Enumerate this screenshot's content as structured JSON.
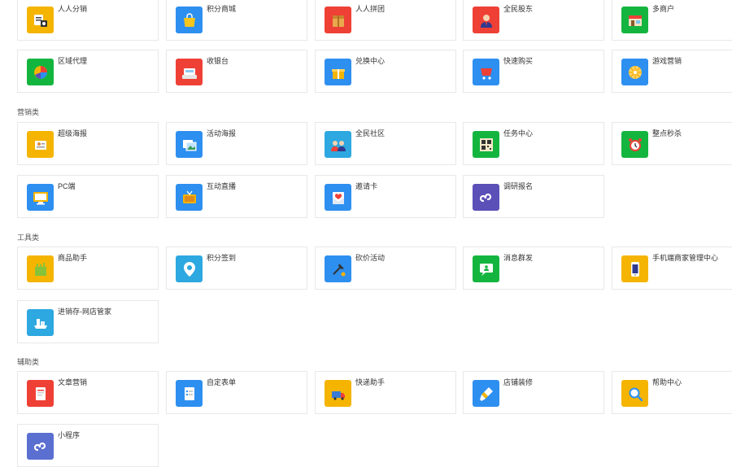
{
  "sections": [
    {
      "title": ""
    },
    {
      "title": "营销类"
    },
    {
      "title": "工具类"
    },
    {
      "title": "辅助类"
    }
  ],
  "apps": [
    {
      "label": "人人分销",
      "icon": "distribution-icon",
      "color": "#f5b400"
    },
    {
      "label": "积分商城",
      "icon": "shopping-bag-icon",
      "color": "#2d8ff0"
    },
    {
      "label": "人人拼团",
      "icon": "group-buy-box-icon",
      "color": "#ef4036"
    },
    {
      "label": "全民股东",
      "icon": "shareholder-person-icon",
      "color": "#ef4036"
    },
    {
      "label": "多商户",
      "icon": "multi-store-icon",
      "color": "#14b53f"
    },
    {
      "label": "区域代理",
      "icon": "region-agent-pie-icon",
      "color": "#14b53f"
    },
    {
      "label": "收银台",
      "icon": "cashier-icon",
      "color": "#ef4036"
    },
    {
      "label": "兑换中心",
      "icon": "gift-icon",
      "color": "#2d8ff0"
    },
    {
      "label": "快速购买",
      "icon": "quick-buy-cart-icon",
      "color": "#2d8ff0"
    },
    {
      "label": "游戏营销",
      "icon": "game-wheel-icon",
      "color": "#2d8ff0"
    },
    {
      "label": "超级海报",
      "icon": "super-poster-icon",
      "color": "#f5b400"
    },
    {
      "label": "活动海报",
      "icon": "activity-poster-icon",
      "color": "#2d8ff0"
    },
    {
      "label": "全民社区",
      "icon": "community-icon",
      "color": "#2da8e0"
    },
    {
      "label": "任务中心",
      "icon": "task-qrcode-icon",
      "color": "#14b53f"
    },
    {
      "label": "整点秒杀",
      "icon": "alarm-clock-icon",
      "color": "#14b53f"
    },
    {
      "label": "PC端",
      "icon": "desktop-monitor-icon",
      "color": "#2d8ff0"
    },
    {
      "label": "互动直播",
      "icon": "live-tv-icon",
      "color": "#2d8ff0"
    },
    {
      "label": "邀请卡",
      "icon": "invite-card-icon",
      "color": "#2d8ff0"
    },
    {
      "label": "调研报名",
      "icon": "mini-program-icon",
      "color": "#5b4fb8"
    },
    {
      "label": "商品助手",
      "icon": "goods-assistant-icon",
      "color": "#f5b400"
    },
    {
      "label": "积分签到",
      "icon": "points-signin-pin-icon",
      "color": "#2da8e0"
    },
    {
      "label": "砍价活动",
      "icon": "bargain-axe-icon",
      "color": "#2d8ff0"
    },
    {
      "label": "消息群发",
      "icon": "message-broadcast-icon",
      "color": "#14b53f"
    },
    {
      "label": "手机端商家管理中心",
      "icon": "mobile-phone-icon",
      "color": "#f5b400"
    },
    {
      "label": "进销存-网店管家",
      "icon": "inventory-icon",
      "color": "#2da8e0"
    },
    {
      "label": "文章营销",
      "icon": "article-icon",
      "color": "#ef4036"
    },
    {
      "label": "自定表单",
      "icon": "custom-form-icon",
      "color": "#2d8ff0"
    },
    {
      "label": "快递助手",
      "icon": "express-truck-icon",
      "color": "#f5b400"
    },
    {
      "label": "店铺装修",
      "icon": "store-decoration-brush-icon",
      "color": "#2d8ff0"
    },
    {
      "label": "帮助中心",
      "icon": "help-search-icon",
      "color": "#f5b400"
    },
    {
      "label": "小程序",
      "icon": "mini-program-icon",
      "color": "#5b6fd1"
    }
  ]
}
